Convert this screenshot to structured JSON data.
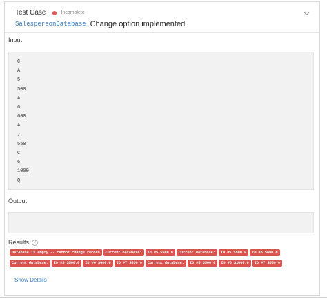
{
  "header": {
    "title": "Test Case",
    "status": "Incomplete"
  },
  "sub": {
    "tag": "SalespersonDatabase",
    "title": "Change option implemented"
  },
  "input": {
    "label": "Input",
    "lines": [
      "C",
      "A",
      "5",
      "500",
      "A",
      "6",
      "600",
      "A",
      "7",
      "550",
      "C",
      "6",
      "1000",
      "Q"
    ]
  },
  "output": {
    "label": "Output",
    "value": ""
  },
  "results": {
    "label": "Results",
    "row1": [
      "Database is empty -- cannot change record",
      "Current database:",
      "ID #5 $500.0",
      "Current database:",
      "ID #5 $500.0",
      "ID #6 $600.0"
    ],
    "row2": [
      "Current database:",
      "ID #5 $500.0",
      "ID #6 $600.0",
      "ID #7 $550.0",
      "Current database:",
      "ID #5 $500.0",
      "ID #6 $1000.0",
      "ID #7 $550.0"
    ]
  },
  "actions": {
    "show_details": "Show Details"
  },
  "colors": {
    "fail_chip": "#d9534f",
    "link": "#3a7bbf",
    "status_dot": "#e05a5a"
  }
}
